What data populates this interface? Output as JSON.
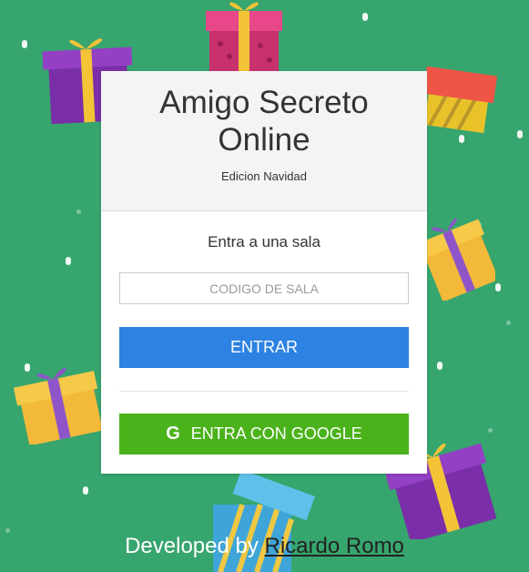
{
  "app": {
    "title": "Amigo Secreto Online",
    "subtitle": "Edicion Navidad"
  },
  "join": {
    "label": "Entra a una sala",
    "code_placeholder": "CODIGO DE SALA",
    "code_value": "",
    "enter_label": "ENTRAR",
    "google_icon": "G",
    "google_label": "ENTRA CON GOOGLE"
  },
  "footer": {
    "prefix": "Developed by ",
    "author": "Ricardo Romo"
  },
  "colors": {
    "background": "#36a56e",
    "enter_button": "#2d82e2",
    "google_button": "#4ab21a"
  }
}
